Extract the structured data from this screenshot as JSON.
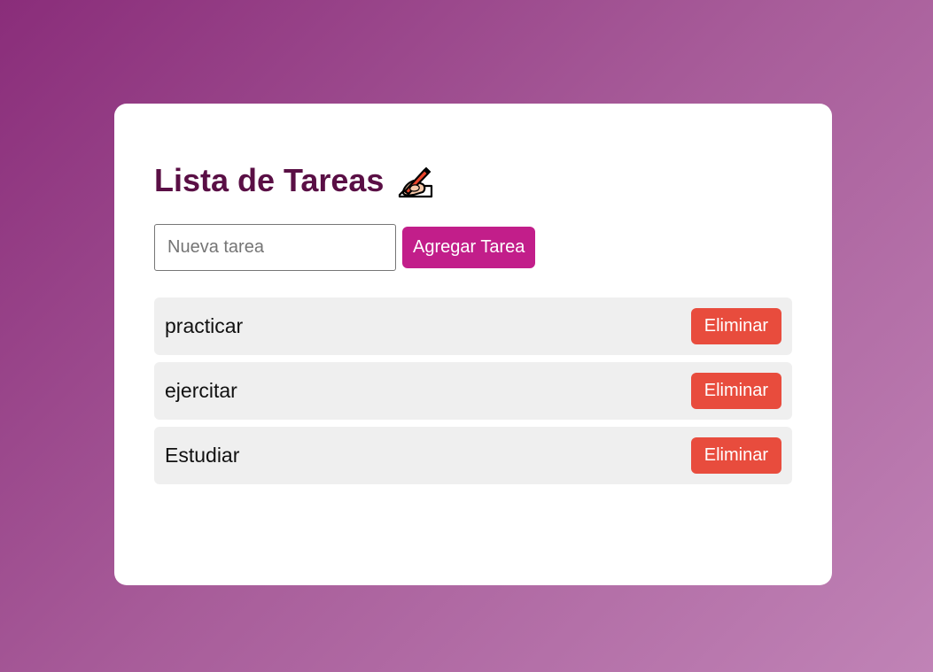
{
  "app": {
    "title": "Lista de Tareas",
    "title_icon": "writing-hand-icon"
  },
  "form": {
    "input_value": "",
    "input_placeholder": "Nueva tarea",
    "add_button_label": "Agregar Tarea"
  },
  "tasks": [
    {
      "text": "practicar",
      "delete_label": "Eliminar"
    },
    {
      "text": "ejercitar",
      "delete_label": "Eliminar"
    },
    {
      "text": "Estudiar",
      "delete_label": "Eliminar"
    }
  ],
  "colors": {
    "background_gradient_start": "#8a2d7a",
    "background_gradient_end": "#c083b6",
    "title": "#5a0f45",
    "add_button": "#c21e8a",
    "delete_button": "#e84c3d",
    "task_item_background": "#efefef"
  }
}
